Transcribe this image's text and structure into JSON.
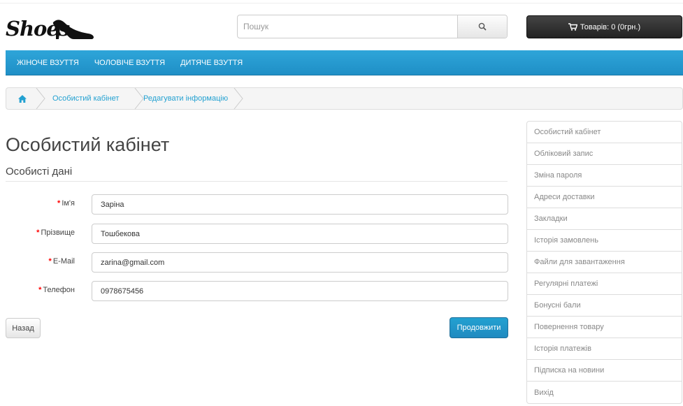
{
  "brand": {
    "logo_text": "Shoes"
  },
  "search": {
    "placeholder": "Пошук",
    "value": ""
  },
  "cart": {
    "label": "Товарів: 0 (0грн.)"
  },
  "menu": {
    "items": [
      "ЖІНОЧЕ ВЗУТТЯ",
      "ЧОЛОВІЧЕ ВЗУТТЯ",
      "ДИТЯЧЕ ВЗУТТЯ"
    ]
  },
  "breadcrumb": {
    "items": [
      "Особистий кабінет",
      "Редагувати інформацію"
    ]
  },
  "page": {
    "title": "Особистий кабінет",
    "section": "Особисті дані"
  },
  "form": {
    "fields": [
      {
        "label": "Ім'я",
        "value": "Заріна"
      },
      {
        "label": "Прізвище",
        "value": "Тошбекова"
      },
      {
        "label": "E-Mail",
        "value": "zarina@gmail.com"
      },
      {
        "label": "Телефон",
        "value": "0978675456"
      }
    ],
    "required_mark": "*",
    "back_label": "Назад",
    "continue_label": "Продовжити"
  },
  "sidebar": {
    "items": [
      "Особистий кабінет",
      "Обліковий запис",
      "Зміна пароля",
      "Адреси доставки",
      "Закладки",
      "Історія замовлень",
      "Файли для завантаження",
      "Регулярні платежі",
      "Бонусні бали",
      "Повернення товару",
      "Історія платежів",
      "Підписка на новини",
      "Вихід"
    ]
  },
  "colors": {
    "accent": "#229ac8",
    "required": "#ff0000",
    "cart_bg": "#2b2b2b"
  },
  "icons": {
    "search": "search-icon",
    "cart": "cart-icon",
    "home": "home-icon"
  }
}
